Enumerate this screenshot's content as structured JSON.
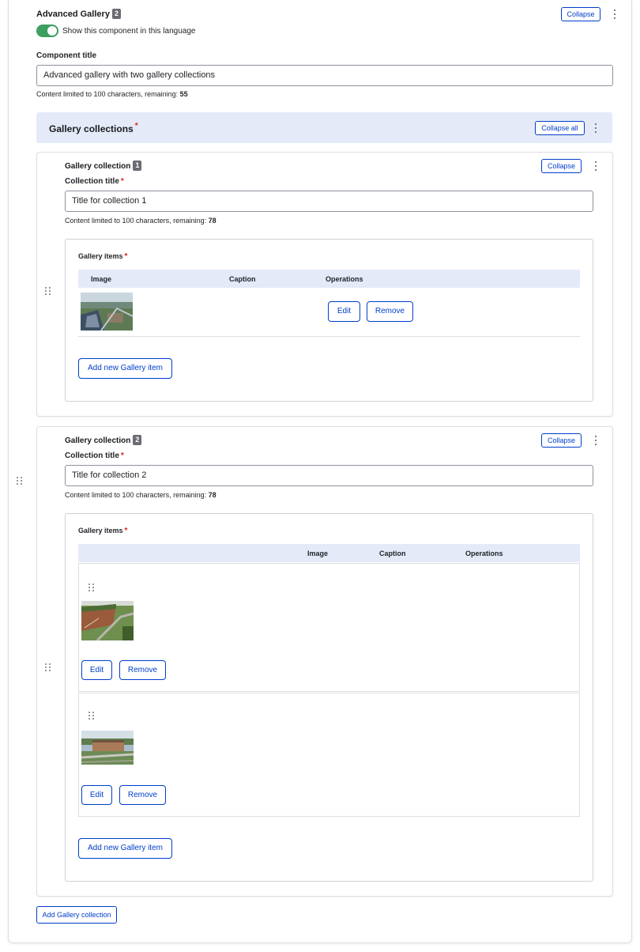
{
  "component": {
    "title": "Advanced Gallery",
    "badge": "2",
    "collapse_label": "Collapse",
    "toggle_label": "Show this component in this language",
    "toggle_on": true,
    "title_field_label": "Component title",
    "title_value": "Advanced gallery with two gallery collections",
    "limit_text": "Content limited to 100 characters, remaining:",
    "limit_remaining": "55"
  },
  "collections_section": {
    "title": "Gallery collections",
    "required_mark": "*",
    "collapse_all_label": "Collapse all"
  },
  "collections": [
    {
      "title": "Gallery collection",
      "badge": "1",
      "collapse_label": "Collapse",
      "field_label": "Collection title",
      "required_mark": "*",
      "value": "Title for collection 1",
      "limit_text": "Content limited to 100 characters, remaining:",
      "limit_remaining": "78",
      "items_label": "Gallery items",
      "headers": {
        "image": "Image",
        "caption": "Caption",
        "operations": "Operations"
      },
      "items": [
        {
          "edit": "Edit",
          "remove": "Remove"
        }
      ],
      "add_item_label": "Add new Gallery item"
    },
    {
      "title": "Gallery collection",
      "badge": "2",
      "collapse_label": "Collapse",
      "field_label": "Collection title",
      "required_mark": "*",
      "value": "Title for collection 2",
      "limit_text": "Content limited to 100 characters, remaining:",
      "limit_remaining": "78",
      "items_label": "Gallery items",
      "headers": {
        "image": "Image",
        "caption": "Caption",
        "operations": "Operations"
      },
      "items": [
        {
          "edit": "Edit",
          "remove": "Remove"
        },
        {
          "edit": "Edit",
          "remove": "Remove"
        }
      ],
      "add_item_label": "Add new Gallery item"
    }
  ],
  "add_collection_label": "Add Gallery collection",
  "colors": {
    "accent": "#003ecc",
    "toggle_on": "#3e9e5f",
    "header_bg": "#e4eaf8",
    "required": "#d72222"
  }
}
